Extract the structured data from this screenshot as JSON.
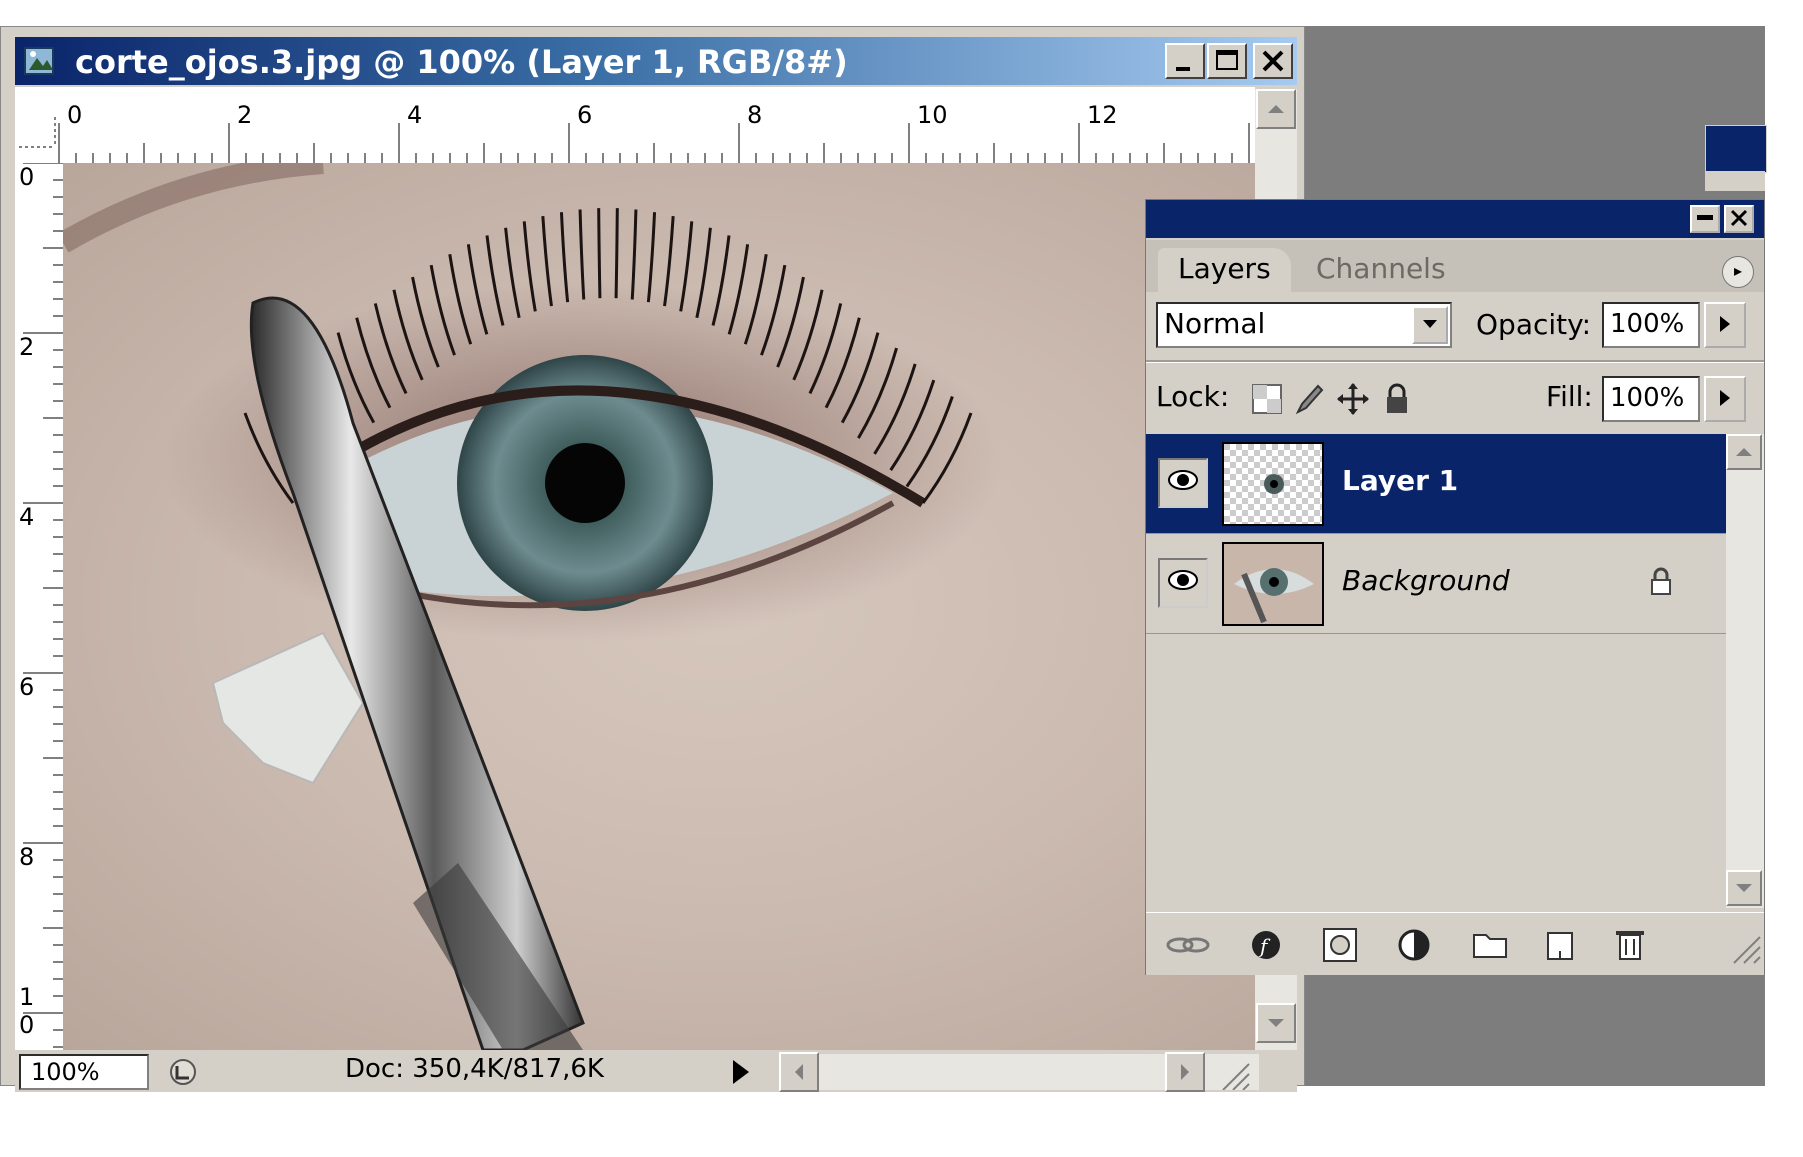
{
  "window": {
    "title": "corte_ojos.3.jpg @ 100% (Layer 1, RGB/8#)"
  },
  "rulers": {
    "top_labels": [
      "0",
      "2",
      "4",
      "6",
      "8",
      "10",
      "12"
    ],
    "left_labels": [
      "0",
      "2",
      "4",
      "6",
      "8",
      "1",
      "0"
    ]
  },
  "status": {
    "zoom": "100%",
    "doc_info": "Doc: 350,4K/817,6K"
  },
  "layers_panel": {
    "tabs": [
      "Layers",
      "Channels"
    ],
    "blend_mode": "Normal",
    "opacity_label": "Opacity:",
    "opacity_value": "100%",
    "lock_label": "Lock:",
    "fill_label": "Fill:",
    "fill_value": "100%",
    "layers": [
      {
        "name": "Layer 1",
        "selected": true,
        "visible": true
      },
      {
        "name": "Background",
        "selected": false,
        "visible": true,
        "locked": true
      }
    ]
  },
  "icons": {
    "eye": "👁",
    "lock": "🔒",
    "menu": "▸"
  },
  "colors": {
    "selection": "#0a246a",
    "panel": "#d4d0c8",
    "workspace": "#7d7d7d"
  }
}
